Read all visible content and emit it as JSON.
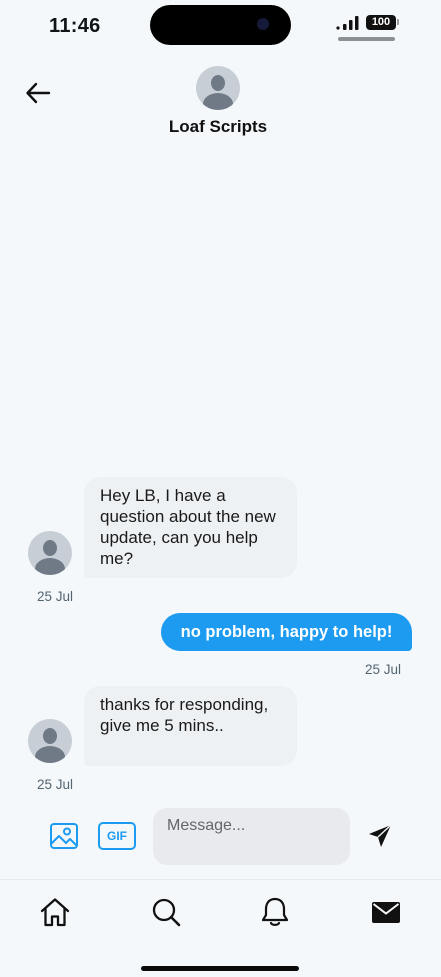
{
  "status_bar": {
    "time": "11:46",
    "battery": "100"
  },
  "header": {
    "contact_name": "Loaf Scripts",
    "back_icon": "arrow-left-icon",
    "avatar_icon": "default-avatar-icon"
  },
  "messages": [
    {
      "direction": "incoming",
      "text": "Hey LB, I have a question about the new update, can you help me?",
      "date": "25 Jul"
    },
    {
      "direction": "outgoing",
      "text": "no problem, happy to help!",
      "date": "25 Jul"
    },
    {
      "direction": "incoming",
      "text": "thanks for responding, give me 5 mins..",
      "date": "25 Jul"
    }
  ],
  "composer": {
    "placeholder": "Message...",
    "gif_label": "GIF",
    "image_icon": "image-icon",
    "send_icon": "send-icon"
  },
  "tabbar": {
    "items": [
      "home-icon",
      "search-icon",
      "bell-icon",
      "mail-icon"
    ]
  },
  "colors": {
    "accent": "#1d9bf0",
    "background": "#f5f8fa",
    "incoming_bubble": "#eef1f3"
  }
}
